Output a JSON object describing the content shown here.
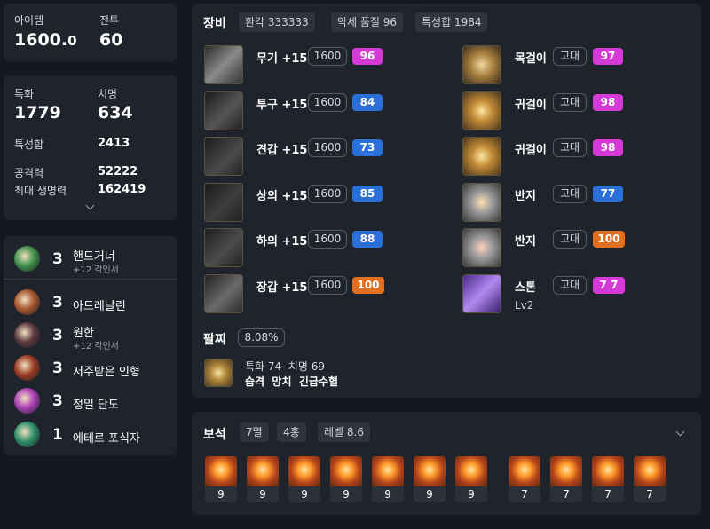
{
  "stats_top": {
    "item_label": "아이템",
    "item_value_main": "1600.",
    "item_value_dec": "0",
    "combat_label": "전투",
    "combat_value": "60"
  },
  "stats_detail": {
    "spec_label": "특화",
    "spec_value": "1779",
    "crit_label": "치명",
    "crit_value": "634",
    "trait_label": "특성합",
    "trait_value": "2413",
    "atk_label": "공격력",
    "atk_value": "52222",
    "hp_label": "최대 생명력",
    "hp_value": "162419"
  },
  "engravings": [
    {
      "level": "3",
      "name": "핸드거너",
      "sub": "+12 각인서",
      "icon": "handgunner-icon",
      "color": "#3f8f4a"
    },
    {
      "level": "3",
      "name": "아드레날린",
      "sub": "",
      "icon": "adrenaline-icon",
      "color": "#a4552c"
    },
    {
      "level": "3",
      "name": "원한",
      "sub": "+12 각인서",
      "icon": "grudge-icon",
      "color": "#5b3a3f"
    },
    {
      "level": "3",
      "name": "저주받은 인형",
      "sub": "",
      "icon": "cursed-doll-icon",
      "color": "#9a3a22"
    },
    {
      "level": "3",
      "name": "정밀 단도",
      "sub": "",
      "icon": "precise-dagger-icon",
      "color": "#a93fb5"
    },
    {
      "level": "1",
      "name": "에테르 포식자",
      "sub": "",
      "icon": "ether-predator-icon",
      "color": "#2f8f6a"
    }
  ],
  "equipment": {
    "title": "장비",
    "chips": [
      "환각 333333",
      "악세 품질 96",
      "특성합 1984"
    ],
    "gear": [
      {
        "name": "무기 +15",
        "ilvl": "1600",
        "quality": "96",
        "qcolor": "#d63ad6",
        "icon": "weapon-icon"
      },
      {
        "name": "투구 +15",
        "ilvl": "1600",
        "quality": "84",
        "qcolor": "#2b6fd9",
        "icon": "helmet-icon"
      },
      {
        "name": "견갑 +15",
        "ilvl": "1600",
        "quality": "73",
        "qcolor": "#2b6fd9",
        "icon": "shoulder-icon"
      },
      {
        "name": "상의 +15",
        "ilvl": "1600",
        "quality": "85",
        "qcolor": "#2b6fd9",
        "icon": "chest-icon"
      },
      {
        "name": "하의 +15",
        "ilvl": "1600",
        "quality": "88",
        "qcolor": "#2b6fd9",
        "icon": "pants-icon"
      },
      {
        "name": "장갑 +15",
        "ilvl": "1600",
        "quality": "100",
        "qcolor": "#e0701f",
        "icon": "gloves-icon"
      }
    ],
    "accessories": [
      {
        "name": "목걸이",
        "grade": "고대",
        "quality": "97",
        "qcolor": "#d63ad6",
        "icon": "necklace-icon"
      },
      {
        "name": "귀걸이",
        "grade": "고대",
        "quality": "98",
        "qcolor": "#d63ad6",
        "icon": "earring-icon"
      },
      {
        "name": "귀걸이",
        "grade": "고대",
        "quality": "98",
        "qcolor": "#d63ad6",
        "icon": "earring-icon"
      },
      {
        "name": "반지",
        "grade": "고대",
        "quality": "77",
        "qcolor": "#2b6fd9",
        "icon": "ring-icon"
      },
      {
        "name": "반지",
        "grade": "고대",
        "quality": "100",
        "qcolor": "#e0701f",
        "icon": "ring-icon"
      },
      {
        "name": "스톤",
        "grade": "고대",
        "quality": "7 7",
        "qcolor": "#d63ad6",
        "icon": "ability-stone-icon",
        "sub": "Lv2"
      }
    ],
    "bracelet": {
      "title": "팔찌",
      "percent": "8.08%",
      "line1": "특화 74  치명 69",
      "line2": "습격  망치  긴급수혈"
    }
  },
  "gems": {
    "title": "보석",
    "chips": [
      "7멸",
      "4홍",
      "레벨 8.6"
    ],
    "levels": [
      "9",
      "9",
      "9",
      "9",
      "9",
      "9",
      "9",
      "7",
      "7",
      "7",
      "7"
    ]
  },
  "colors": {
    "bg": "#15181e",
    "panel": "#1f232b",
    "purple": "#d63ad6",
    "blue": "#2b6fd9",
    "orange": "#e0701f"
  }
}
